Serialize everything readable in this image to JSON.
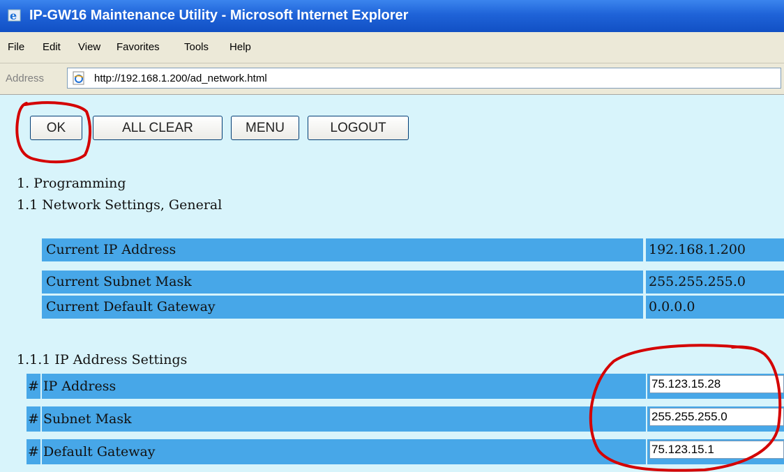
{
  "window": {
    "title": "IP-GW16 Maintenance Utility - Microsoft Internet Explorer"
  },
  "menu": {
    "items": [
      "File",
      "Edit",
      "View",
      "Favorites",
      "Tools",
      "Help"
    ]
  },
  "address": {
    "label": "Address",
    "url": "http://192.168.1.200/ad_network.html"
  },
  "toolbar": {
    "ok_label": "OK",
    "all_clear_label": "ALL CLEAR",
    "menu_label": "MENU",
    "logout_label": "LOGOUT"
  },
  "content": {
    "section": "1. Programming",
    "subsection": "1.1 Network Settings, General",
    "current": [
      {
        "label": "Current IP Address",
        "value": "192.168.1.200"
      },
      {
        "label": "Current Subnet Mask",
        "value": "255.255.255.0"
      },
      {
        "label": "Current Default Gateway",
        "value": "0.0.0.0"
      }
    ],
    "ip_settings_heading": "1.1.1 IP Address Settings",
    "settings": [
      {
        "marker": "#",
        "label": "IP Address",
        "value": "75.123.15.28"
      },
      {
        "marker": "#",
        "label": "Subnet Mask",
        "value": "255.255.255.0"
      },
      {
        "marker": "#",
        "label": "Default Gateway",
        "value": "75.123.15.1"
      }
    ]
  },
  "colors": {
    "page_background": "#d8f4fb",
    "row_background": "#47a7e8",
    "title_bar": "#1f63d8",
    "annotation_red": "#d40000"
  }
}
